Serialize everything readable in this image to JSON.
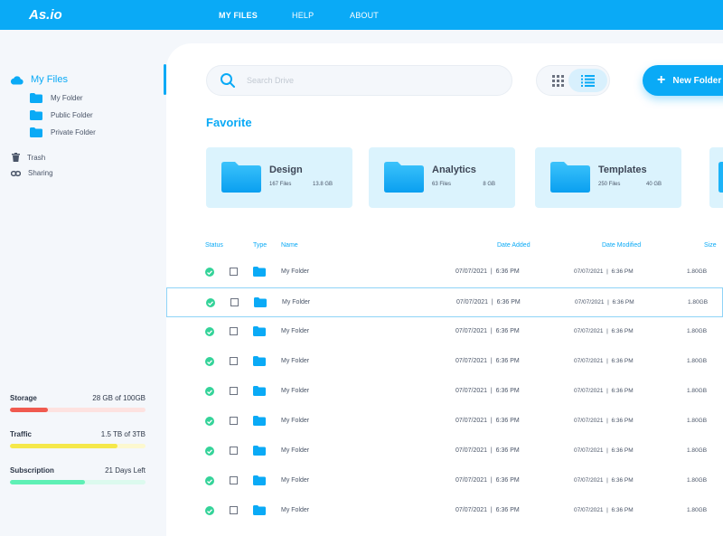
{
  "app": {
    "title": "As.io"
  },
  "nav": [
    {
      "label": "MY FILES",
      "active": true
    },
    {
      "label": "HELP",
      "active": false
    },
    {
      "label": "ABOUT",
      "active": false
    }
  ],
  "sidebar": {
    "main": {
      "label": "My Files",
      "icon": "cloud-icon"
    },
    "folders": [
      {
        "label": "My Folder",
        "icon": "folder-icon"
      },
      {
        "label": "Public Folder",
        "icon": "folder-icon"
      },
      {
        "label": "Private Folder",
        "icon": "folder-icon"
      }
    ],
    "misc": [
      {
        "label": "Trash",
        "icon": "trash-icon"
      },
      {
        "label": "Sharing",
        "icon": "link-icon"
      }
    ],
    "stats": [
      {
        "name": "Storage",
        "value": "28 GB of 100GB",
        "fraction": 0.28,
        "color": "#f05a4f",
        "track": "#fde2e0"
      },
      {
        "name": "Traffic",
        "value": "1.5 TB of 3TB",
        "fraction": 0.79,
        "color": "#f5e84a",
        "track": "#fcf8cf"
      },
      {
        "name": "Subscription",
        "value": "21 Days Left",
        "fraction": 0.55,
        "color": "#5ef0b5",
        "track": "#dcfaee"
      }
    ]
  },
  "toolbar": {
    "search_placeholder": "Search Drive",
    "new_folder_label": "New Folder"
  },
  "favorite": {
    "title": "Favorite",
    "cards": [
      {
        "name": "Design",
        "files": "167 Files",
        "size": "13.8 GB"
      },
      {
        "name": "Analytics",
        "files": "63 Files",
        "size": "8 GB"
      },
      {
        "name": "Templates",
        "files": "250 Files",
        "size": "40 GB"
      }
    ]
  },
  "table": {
    "headers": {
      "status": "Status",
      "type": "Type",
      "name": "Name",
      "date_added": "Date Added",
      "date_modified": "Date Modified",
      "size": "Size"
    },
    "rows": [
      {
        "name": "My Folder",
        "date_added": "07/07/2021  |  6:36 PM",
        "date_modified": "07/07/2021  |  6:36 PM",
        "size": "1.80GB",
        "selected": false
      },
      {
        "name": "My Folder",
        "date_added": "07/07/2021  |  6:36 PM",
        "date_modified": "07/07/2021  |  6:36 PM",
        "size": "1.80GB",
        "selected": true
      },
      {
        "name": "My Folder",
        "date_added": "07/07/2021  |  6:36 PM",
        "date_modified": "07/07/2021  |  6:36 PM",
        "size": "1.80GB",
        "selected": false
      },
      {
        "name": "My Folder",
        "date_added": "07/07/2021  |  6:36 PM",
        "date_modified": "07/07/2021  |  6:36 PM",
        "size": "1.80GB",
        "selected": false
      },
      {
        "name": "My Folder",
        "date_added": "07/07/2021  |  6:36 PM",
        "date_modified": "07/07/2021  |  6:36 PM",
        "size": "1.80GB",
        "selected": false
      },
      {
        "name": "My Folder",
        "date_added": "07/07/2021  |  6:36 PM",
        "date_modified": "07/07/2021  |  6:36 PM",
        "size": "1.80GB",
        "selected": false
      },
      {
        "name": "My Folder",
        "date_added": "07/07/2021  |  6:36 PM",
        "date_modified": "07/07/2021  |  6:36 PM",
        "size": "1.80GB",
        "selected": false
      },
      {
        "name": "My Folder",
        "date_added": "07/07/2021  |  6:36 PM",
        "date_modified": "07/07/2021  |  6:36 PM",
        "size": "1.80GB",
        "selected": false
      },
      {
        "name": "My Folder",
        "date_added": "07/07/2021  |  6:36 PM",
        "date_modified": "07/07/2021  |  6:36 PM",
        "size": "1.80GB",
        "selected": false
      }
    ]
  },
  "colors": {
    "accent": "#0aaaf6",
    "status_ok": "#34d399",
    "card_bg": "#dbf3fd"
  }
}
